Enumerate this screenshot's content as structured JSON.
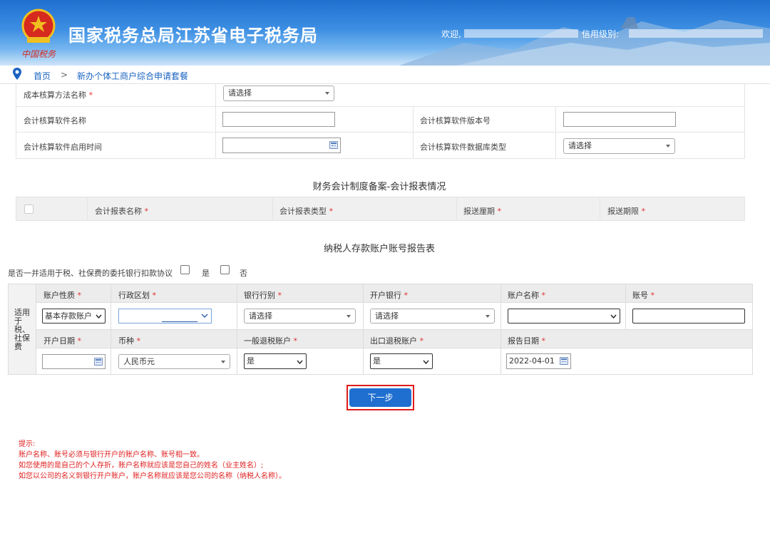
{
  "header": {
    "site_title": "国家税务总局江苏省电子税务局",
    "emblem_text": "中国税务",
    "welcome_label": "欢迎,",
    "credit_label": "信用级别:"
  },
  "breadcrumb": {
    "home": "首页",
    "separator": ">",
    "current": "新办个体工商户综合申请套餐"
  },
  "cost_form": {
    "cost_method_label": "成本核算方法名称",
    "cost_method_value": "请选择",
    "software_name_label": "会计核算软件名称",
    "software_version_label": "会计核算软件版本号",
    "software_start_label": "会计核算软件启用时间",
    "db_type_label": "会计核算软件数据库类型",
    "db_type_value": "请选择",
    "required_mark": "*"
  },
  "report_section": {
    "title": "财务会计制度备案-会计报表情况",
    "columns": [
      "会计报表名称",
      "会计报表类型",
      "报送厘期",
      "报送期限"
    ]
  },
  "account_section": {
    "title": "纳税人存款账户账号报告表",
    "question": "是否一并适用于税、社保费的委托银行扣款协议",
    "yes": "是",
    "no": "否",
    "side_label": "适用于税、社保费",
    "header1": [
      "账户性质",
      "行政区划",
      "银行行别",
      "开户银行",
      "账户名称",
      "账号"
    ],
    "account_type_value": "基本存款账户",
    "bank_type_value": "请选择",
    "open_bank_value": "请选择",
    "header2": [
      "开户日期",
      "币种",
      "一般退税账户",
      "出口退税账户",
      "报告日期"
    ],
    "currency_value": "人民币元",
    "general_refund_value": "是",
    "export_refund_value": "是",
    "report_date_value": "2022-04-01"
  },
  "next_button": "下一步",
  "tips": [
    "提示:",
    "账户名称、账号必须与银行开户的账户名称、账号相一致。",
    "如您使用的是自己的个人存折，账户名称就应该是您自己的姓名（业主姓名）;",
    "如您以公司的名义到银行开户账户，账户名称就应该是您公司的名称（纳税人名称）。"
  ],
  "colors": {
    "primary": "#1f6fd0",
    "required": "#e03030",
    "tip": "#e02020"
  }
}
